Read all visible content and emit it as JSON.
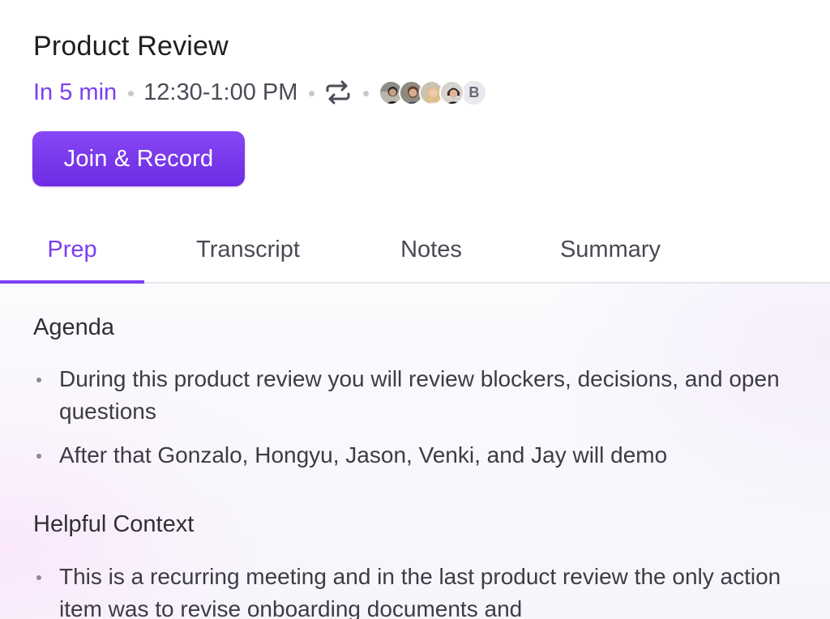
{
  "meeting": {
    "title": "Product Review",
    "time_until": "In 5 min",
    "time_range": "12:30-1:00 PM",
    "recurring_icon": "repeat-icon",
    "attendees": [
      {
        "kind": "photo",
        "icon": "avatar-person-1"
      },
      {
        "kind": "photo",
        "icon": "avatar-person-2"
      },
      {
        "kind": "photo",
        "icon": "avatar-person-3"
      },
      {
        "kind": "photo",
        "icon": "avatar-person-4"
      },
      {
        "kind": "initial",
        "initial": "B"
      }
    ]
  },
  "actions": {
    "join_label": "Join & Record"
  },
  "tabs": [
    {
      "label": "Prep",
      "active": true
    },
    {
      "label": "Transcript",
      "active": false
    },
    {
      "label": "Notes",
      "active": false
    },
    {
      "label": "Summary",
      "active": false
    }
  ],
  "prep": {
    "agenda": {
      "heading": "Agenda",
      "items": [
        "During this product review you will review blockers, decisions, and open questions",
        "After that Gonzalo, Hongyu, Jason, Venki, and Jay will demo"
      ]
    },
    "context": {
      "heading": "Helpful Context",
      "items": [
        "This is a recurring meeting and in the last product review the only action item was to revise onboarding documents and"
      ]
    }
  },
  "colors": {
    "accent": "#7b3ff2",
    "button_gradient_top": "#8747f5",
    "button_gradient_bottom": "#6d2ce2",
    "text_primary": "#1e1e23",
    "text_secondary": "#4b4953"
  }
}
